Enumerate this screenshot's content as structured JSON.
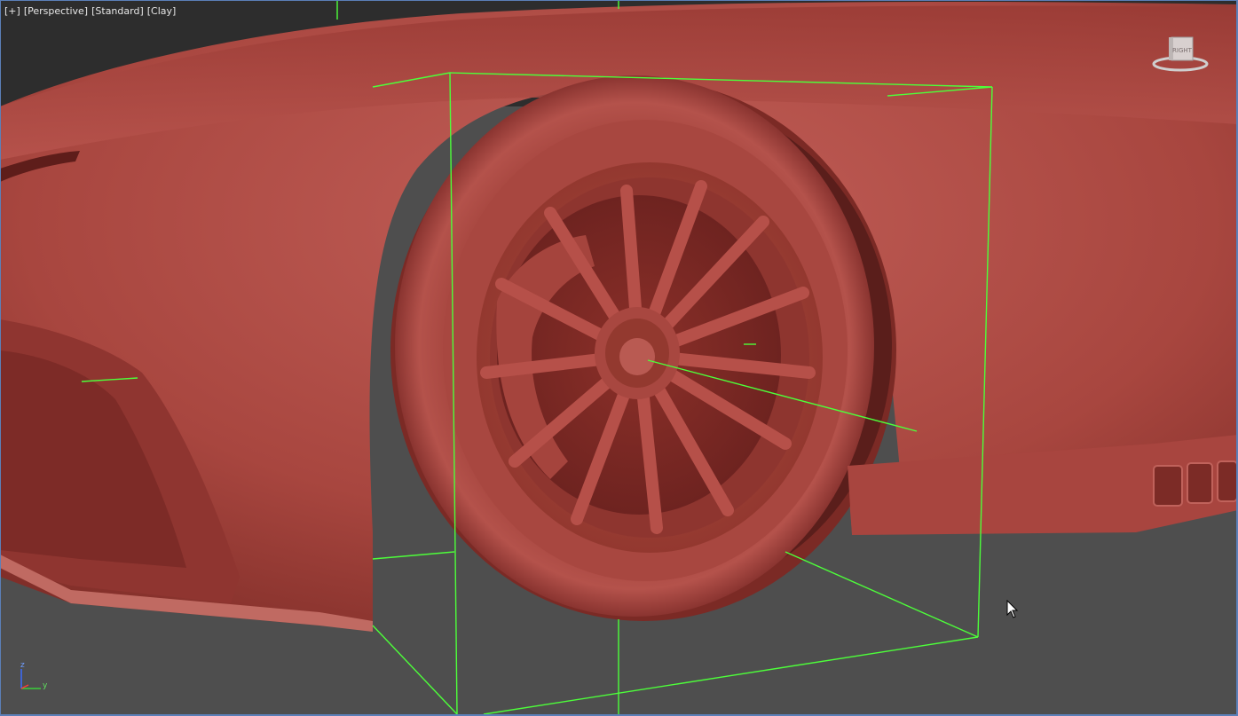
{
  "viewport": {
    "labels": [
      "[+]",
      "[Perspective]",
      "[Standard]",
      "[Clay]"
    ],
    "viewcube_face": "RIGHT",
    "axis_labels": {
      "z": "z",
      "y": "y"
    }
  },
  "colors": {
    "clay": "#b5504a",
    "clay_dark": "#7d2a26",
    "background": "#4a4a4a",
    "selection_bbox": "#4dff3a",
    "viewport_border": "#5b7fb8"
  },
  "icons": {
    "cursor": "arrow-cursor-icon",
    "viewcube": "viewcube-icon",
    "axis": "axis-tripod-icon"
  }
}
